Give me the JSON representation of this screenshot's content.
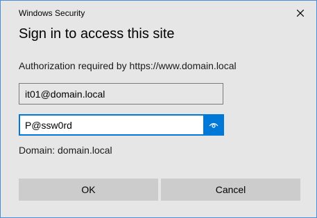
{
  "window": {
    "title": "Windows Security",
    "close_icon": "close-icon"
  },
  "dialog": {
    "heading": "Sign in to access this site",
    "auth_message": "Authorization required by https://www.domain.local",
    "domain_text": "Domain: domain.local"
  },
  "form": {
    "username_value": "it01@domain.local",
    "password_value": "P@ssw0rd",
    "reveal_icon": "eye-icon"
  },
  "buttons": {
    "ok_label": "OK",
    "cancel_label": "Cancel"
  },
  "colors": {
    "accent": "#0078d7",
    "dialog_background": "#e6e6e6",
    "button_background": "#cccccc",
    "window_border": "#4a8fd4"
  }
}
